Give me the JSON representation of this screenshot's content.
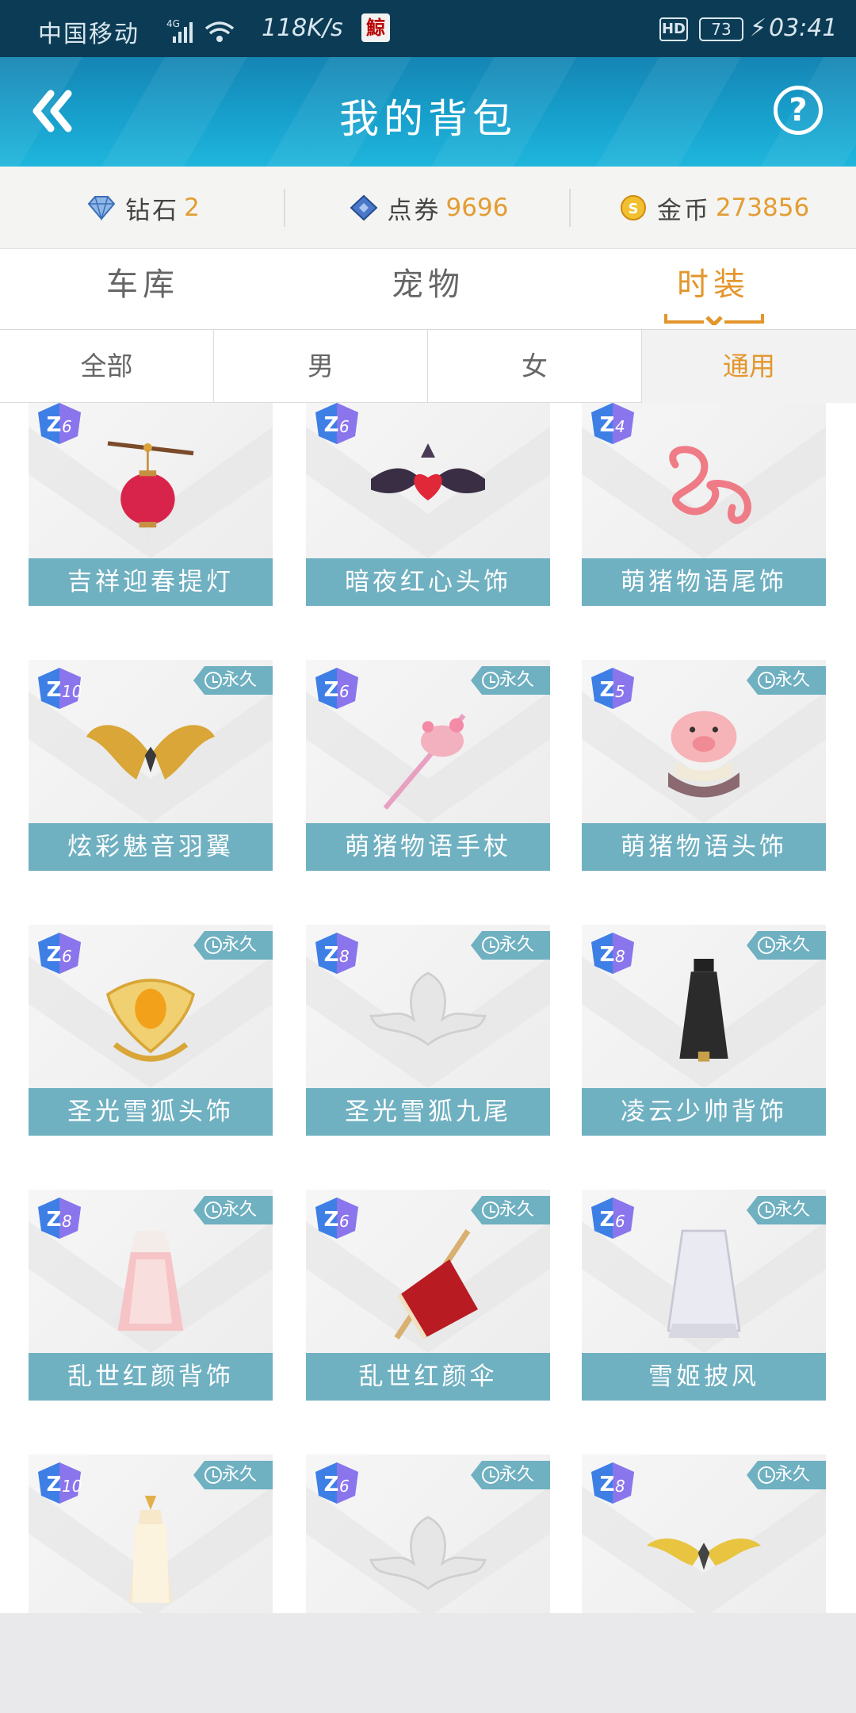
{
  "status_bar": {
    "carrier": "中国移动",
    "network": "4G",
    "speed": "118K/s",
    "app_icon_char": "鯨",
    "hd": "HD",
    "battery": "73",
    "time": "03:41"
  },
  "header": {
    "title": "我的背包",
    "back_icon": "double-chevron-left-icon",
    "help_label": "?"
  },
  "currency": [
    {
      "label": "钻石",
      "value": "2",
      "icon": "diamond-icon"
    },
    {
      "label": "点券",
      "value": "9696",
      "icon": "coupon-icon"
    },
    {
      "label": "金币",
      "value": "273856",
      "icon": "gold-coin-icon"
    }
  ],
  "tabs": [
    {
      "label": "车库",
      "active": false
    },
    {
      "label": "宠物",
      "active": false
    },
    {
      "label": "时装",
      "active": true
    }
  ],
  "subtabs": [
    {
      "label": "全部",
      "active": false
    },
    {
      "label": "男",
      "active": false
    },
    {
      "label": "女",
      "active": false
    },
    {
      "label": "通用",
      "active": true
    }
  ],
  "badge_label": "永久",
  "accent": "#e3962c",
  "items": [
    {
      "name": "吉祥迎春提灯",
      "level": "6",
      "badge": false
    },
    {
      "name": "暗夜红心头饰",
      "level": "6",
      "badge": false
    },
    {
      "name": "萌猪物语尾饰",
      "level": "4",
      "badge": false
    },
    {
      "name": "炫彩魅音羽翼",
      "level": "10",
      "badge": true
    },
    {
      "name": "萌猪物语手杖",
      "level": "6",
      "badge": true
    },
    {
      "name": "萌猪物语头饰",
      "level": "5",
      "badge": true
    },
    {
      "name": "圣光雪狐头饰",
      "level": "6",
      "badge": true
    },
    {
      "name": "圣光雪狐九尾",
      "level": "8",
      "badge": true
    },
    {
      "name": "凌云少帅背饰",
      "level": "8",
      "badge": true
    },
    {
      "name": "乱世红颜背饰",
      "level": "8",
      "badge": true
    },
    {
      "name": "乱世红颜伞",
      "level": "6",
      "badge": true
    },
    {
      "name": "雪姬披风",
      "level": "6",
      "badge": true
    },
    {
      "name": "",
      "level": "10",
      "badge": true
    },
    {
      "name": "",
      "level": "6",
      "badge": true
    },
    {
      "name": "",
      "level": "8",
      "badge": true
    }
  ]
}
